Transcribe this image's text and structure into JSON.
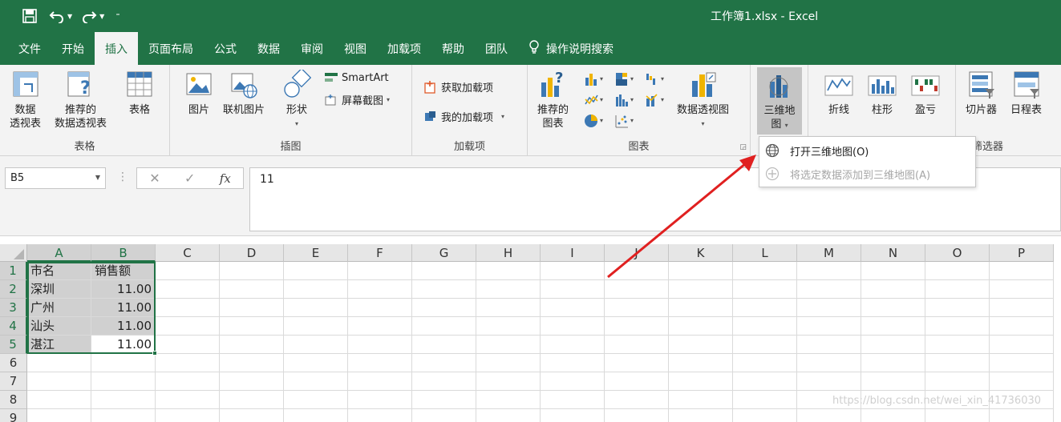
{
  "window": {
    "title": "工作簿1.xlsx  -  Excel"
  },
  "qat": {
    "save_icon": "save-icon",
    "undo_icon": "undo-icon",
    "redo_icon": "redo-icon"
  },
  "tabs": [
    {
      "label": "文件"
    },
    {
      "label": "开始"
    },
    {
      "label": "插入",
      "active": true
    },
    {
      "label": "页面布局"
    },
    {
      "label": "公式"
    },
    {
      "label": "数据"
    },
    {
      "label": "审阅"
    },
    {
      "label": "视图"
    },
    {
      "label": "加载项"
    },
    {
      "label": "帮助"
    },
    {
      "label": "团队"
    }
  ],
  "tellme": {
    "label": "操作说明搜索"
  },
  "ribbon": {
    "tables": {
      "label": "表格",
      "pivot_l1": "数据",
      "pivot_l2": "透视表",
      "rec_pivot_l1": "推荐的",
      "rec_pivot_l2": "数据透视表",
      "table": "表格"
    },
    "illustrations": {
      "label": "插图",
      "pictures": "图片",
      "online_pictures": "联机图片",
      "shapes": "形状",
      "smartart": "SmartArt",
      "screenshot": "屏幕截图"
    },
    "addins": {
      "label": "加载项",
      "get": "获取加载项",
      "my": "我的加载项"
    },
    "charts": {
      "label": "图表",
      "recommended_l1": "推荐的",
      "recommended_l2": "图表",
      "pivotchart": "数据透视图"
    },
    "tours": {
      "map3d_l1": "三维地",
      "map3d_l2": "图"
    },
    "sparklines": {
      "line": "折线",
      "column": "柱形",
      "winloss": "盈亏"
    },
    "filters": {
      "label": "筛选器",
      "slicer": "切片器",
      "timeline": "日程表"
    }
  },
  "menu": {
    "open": "打开三维地图(O)",
    "add": "将选定数据添加到三维地图(A)"
  },
  "formula": {
    "namebox": "B5",
    "value": "11",
    "fx": "fx"
  },
  "grid": {
    "columns": [
      "A",
      "B",
      "C",
      "D",
      "E",
      "F",
      "G",
      "H",
      "I",
      "J",
      "K",
      "L",
      "M",
      "N",
      "O",
      "P"
    ],
    "rows": [
      "1",
      "2",
      "3",
      "4",
      "5",
      "6",
      "7",
      "8",
      "9"
    ],
    "data": [
      [
        "市名",
        "销售额"
      ],
      [
        "深圳",
        "11.00"
      ],
      [
        "广州",
        "11.00"
      ],
      [
        "汕头",
        "11.00"
      ],
      [
        "湛江",
        "11.00"
      ]
    ]
  },
  "watermark": "https://blog.csdn.net/wei_xin_41736030",
  "colors": {
    "accent": "#217346",
    "arrow": "#e02020"
  }
}
